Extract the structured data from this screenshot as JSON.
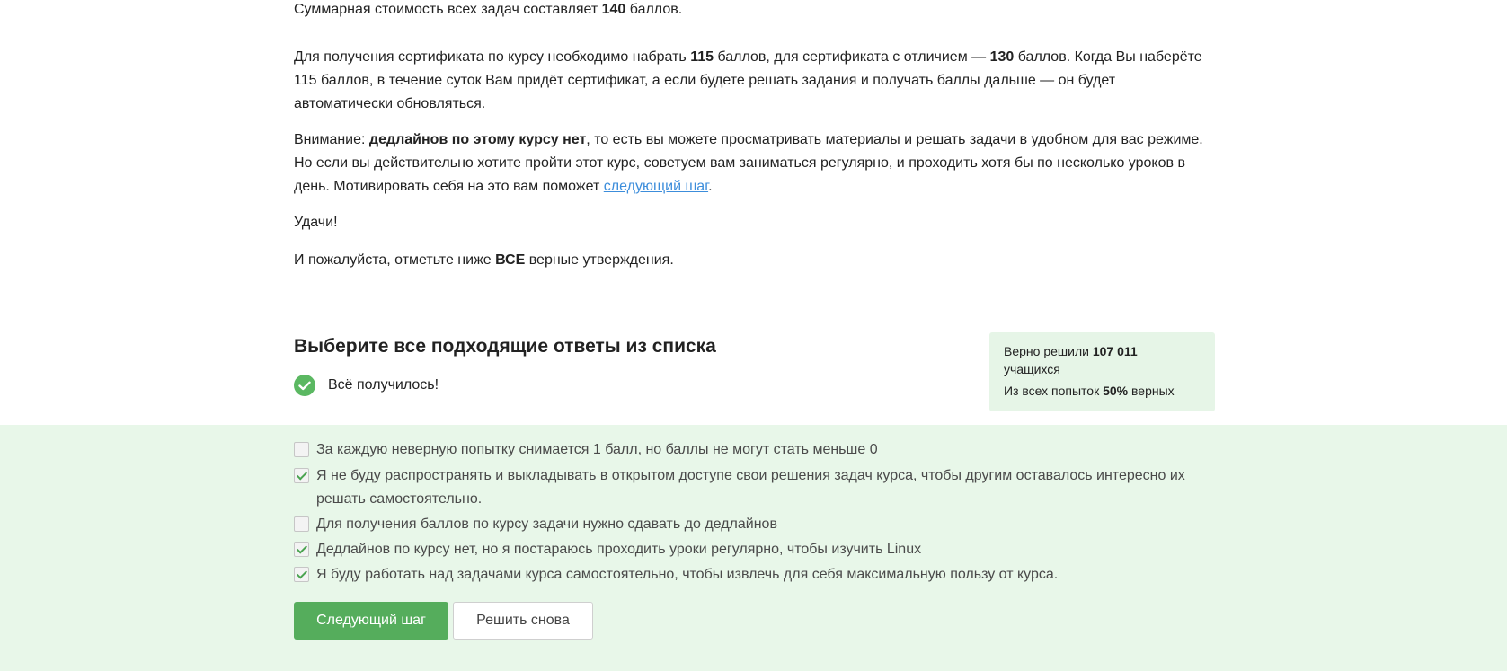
{
  "intro": {
    "p1_a": "Суммарная стоимость всех задач составляет ",
    "p1_b": "140",
    "p1_c": " баллов.",
    "p2_a": "Для получения сертификата по курсу необходимо набрать ",
    "p2_b": "115",
    "p2_c": " баллов, для сертификата с отличием — ",
    "p2_d": "130",
    "p2_e": " баллов. Когда Вы наберёте 115 баллов, в течение суток Вам придёт сертификат, а если будете решать задания и получать баллы дальше — он будет автоматически обновляться.",
    "p3_a": "Внимание: ",
    "p3_b": "дедлайнов по этому курсу нет",
    "p3_c": ", то есть вы можете просматривать материалы и решать задачи в удобном для вас режиме. Но если вы действительно хотите пройти этот курс, советуем вам заниматься регулярно, и проходить хотя бы по несколько уроков в день. Мотивировать себя на это вам поможет ",
    "p3_link": "следующий шаг",
    "p3_d": ".",
    "p4": "Удачи!",
    "p5_a": "И пожалуйста, отметьте ниже ",
    "p5_b": "ВСЕ",
    "p5_c": " верные утверждения."
  },
  "quiz": {
    "title": "Выберите все подходящие ответы из списка",
    "success_text": "Всё получилось!",
    "success_color": "#5bb862"
  },
  "stats": {
    "solved_label": "Верно решили ",
    "solved_count": "107 011",
    "solved_suffix": "учащихся",
    "attempts_label": "Из всех попыток ",
    "attempts_percent": "50%",
    "attempts_suffix": " верных"
  },
  "options": [
    {
      "text": "За каждую неверную попытку снимается 1 балл, но баллы не могут стать меньше 0",
      "checked": false
    },
    {
      "text": "Я не буду распространять и выкладывать в открытом доступе свои решения задач курса, чтобы другим оставалось интересно их решать самостоятельно.",
      "checked": true
    },
    {
      "text": "Для получения баллов по курсу задачи нужно сдавать до дедлайнов",
      "checked": false
    },
    {
      "text": "Дедлайнов по курсу нет, но я постараюсь проходить уроки регулярно, чтобы изучить Linux",
      "checked": true
    },
    {
      "text": "Я буду работать над задачами курса самостоятельно, чтобы извлечь для себя максимальную пользу от курса.",
      "checked": true
    }
  ],
  "buttons": {
    "next_step": "Следующий шаг",
    "solve_again": "Решить снова"
  },
  "colors": {
    "accent_green": "#55ad5c",
    "answers_bg": "#e8f7e9",
    "stats_bg": "#e6f5e7",
    "link": "#3c8ddb"
  }
}
